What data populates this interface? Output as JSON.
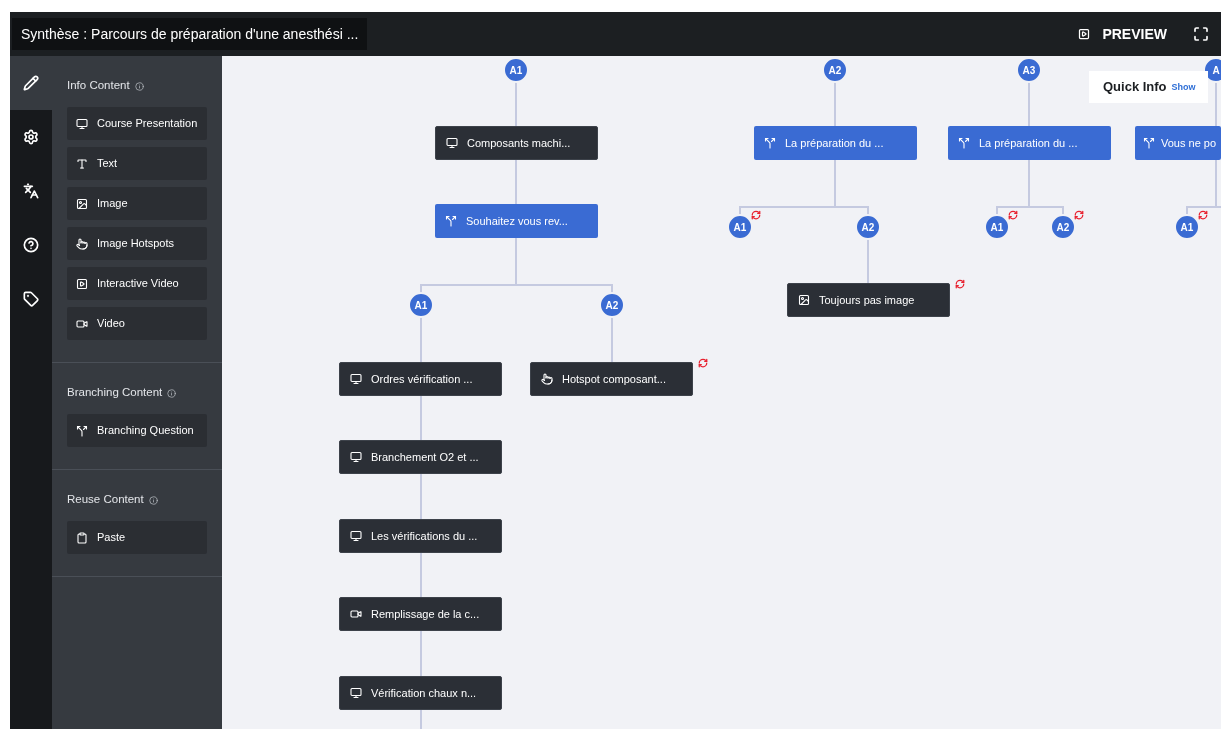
{
  "header": {
    "title": "Synthèse : Parcours de préparation d'une anesthési ...",
    "preview": "PREVIEW"
  },
  "rail": [
    {
      "kind": "edit",
      "selected": true
    },
    {
      "kind": "settings",
      "selected": false
    },
    {
      "kind": "translate",
      "selected": false
    },
    {
      "kind": "help",
      "selected": false
    },
    {
      "kind": "tag",
      "selected": false
    }
  ],
  "sections": [
    {
      "title": "Info Content",
      "items": [
        {
          "kind": "presentation",
          "label": "Course Presentation"
        },
        {
          "kind": "text",
          "label": "Text"
        },
        {
          "kind": "image",
          "label": "Image"
        },
        {
          "kind": "hotspots",
          "label": "Image Hotspots"
        },
        {
          "kind": "interactive_video",
          "label": "Interactive Video"
        },
        {
          "kind": "video",
          "label": "Video"
        }
      ]
    },
    {
      "title": "Branching Content",
      "items": [
        {
          "kind": "branching",
          "label": "Branching Question"
        }
      ]
    },
    {
      "title": "Reuse Content",
      "items": [
        {
          "kind": "paste",
          "label": "Paste"
        }
      ]
    }
  ],
  "quick_info": {
    "title": "Quick Info",
    "link": "Show"
  },
  "tree": [
    {
      "answer": "A1",
      "content": [
        {
          "kind": "presentation",
          "label": "Composants machi..."
        },
        {
          "kind": "branching",
          "label": "Souhaitez vous rev...",
          "answers": [
            {
              "answer": "A1",
              "continues_below": true,
              "content": [
                {
                  "kind": "presentation",
                  "label": "Ordres vérification ..."
                },
                {
                  "kind": "presentation",
                  "label": "Branchement O2 et ..."
                },
                {
                  "kind": "presentation",
                  "label": "Les vérifications du ..."
                },
                {
                  "kind": "video",
                  "label": "Remplissage de la c..."
                },
                {
                  "kind": "presentation",
                  "label": "Vérification chaux n..."
                }
              ]
            },
            {
              "answer": "A2",
              "loop": true,
              "content": [
                {
                  "kind": "hotspots",
                  "label": "Hotspot composant..."
                }
              ]
            }
          ]
        }
      ]
    },
    {
      "answer": "A2",
      "content": [
        {
          "kind": "branching",
          "label": "La préparation du ...",
          "answers": [
            {
              "answer": "A1",
              "loop": true
            },
            {
              "answer": "A2",
              "loop": true,
              "content": [
                {
                  "kind": "image",
                  "label": "Toujours pas image"
                }
              ]
            }
          ]
        }
      ]
    },
    {
      "answer": "A3",
      "content": [
        {
          "kind": "branching",
          "label": "La préparation du ...",
          "answers": [
            {
              "answer": "A1",
              "loop": true
            },
            {
              "answer": "A2",
              "loop": true
            }
          ]
        }
      ]
    },
    {
      "answer": "A",
      "content": [
        {
          "kind": "branching",
          "label": "Vous ne po",
          "answers": [
            {
              "answer": "A1",
              "loop": true
            }
          ]
        }
      ]
    }
  ]
}
